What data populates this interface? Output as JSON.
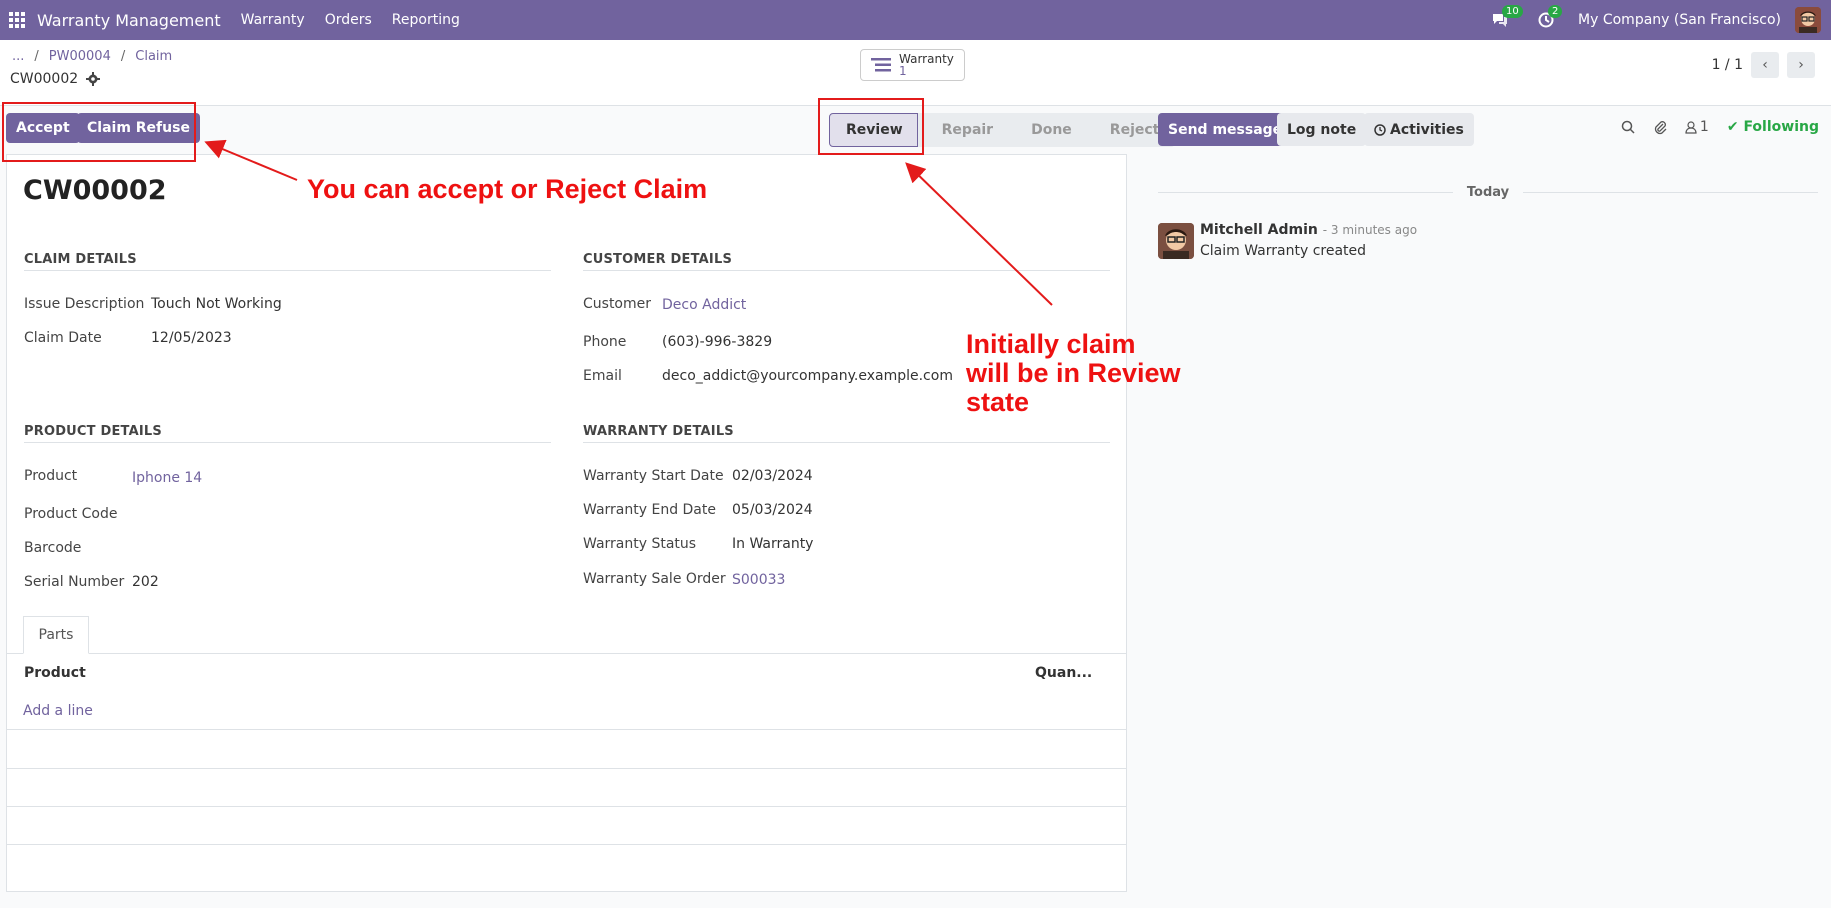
{
  "navbar": {
    "app_title": "Warranty Management",
    "menus": [
      "Warranty",
      "Orders",
      "Reporting"
    ],
    "messages_count": "10",
    "activities_count": "2",
    "company": "My Company (San Francisco)"
  },
  "control": {
    "breadcrumb_more": "...",
    "breadcrumb_1": "PW00004",
    "breadcrumb_2": "Claim",
    "record": "CW00002",
    "smart_button_label": "Warranty",
    "smart_button_count": "1",
    "pager": "1 / 1"
  },
  "statusbar": {
    "accept": "Accept",
    "refuse": "Claim Refuse",
    "stages": [
      "Review",
      "Repair",
      "Done",
      "Reject"
    ],
    "current_stage": "Review"
  },
  "form": {
    "title": "CW00002",
    "claim_details": {
      "heading": "CLAIM DETAILS",
      "issue_label": "Issue Description",
      "issue_value": "Touch Not Working",
      "date_label": "Claim Date",
      "date_value": "12/05/2023"
    },
    "customer_details": {
      "heading": "CUSTOMER DETAILS",
      "customer_label": "Customer",
      "customer_value": "Deco Addict",
      "phone_label": "Phone",
      "phone_value": "(603)-996-3829",
      "email_label": "Email",
      "email_value": "deco_addict@yourcompany.example.com"
    },
    "product_details": {
      "heading": "PRODUCT DETAILS",
      "product_label": "Product",
      "product_value": "Iphone 14",
      "code_label": "Product Code",
      "barcode_label": "Barcode",
      "serial_label": "Serial Number",
      "serial_value": "202"
    },
    "warranty_details": {
      "heading": "WARRANTY DETAILS",
      "start_label": "Warranty Start Date",
      "start_value": "02/03/2024",
      "end_label": "Warranty End Date",
      "end_value": "05/03/2024",
      "status_label": "Warranty Status",
      "status_value": "In Warranty",
      "order_label": "Warranty Sale Order",
      "order_value": "S00033"
    },
    "parts_tab": "Parts",
    "col_product": "Product",
    "col_quantity": "Quan...",
    "add_line": "Add a line"
  },
  "chatter": {
    "send_message": "Send message",
    "log_note": "Log note",
    "activities": "Activities",
    "followers_count": "1",
    "following": "Following",
    "today": "Today",
    "author": "Mitchell Admin",
    "time": "- 3 minutes ago",
    "body": "Claim Warranty created"
  },
  "annotations": {
    "note_accept": "You can accept or Reject Claim",
    "note_review_1": "Initially claim",
    "note_review_2": "will be in Review",
    "note_review_3": "state",
    "color": "#e31b1b"
  }
}
